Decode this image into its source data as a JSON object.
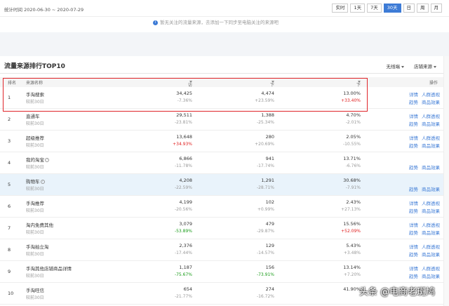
{
  "topbar": {
    "range_label": "统计时间 2020-06-30 ~ 2020-07-29",
    "periods": [
      "实时",
      "1天",
      "7天",
      "30天",
      "日",
      "周",
      "月"
    ],
    "active_period": "30天"
  },
  "notice": {
    "text": "暂无关注的流量来源，去添加一下同步至电脑关注的来源吧"
  },
  "panel": {
    "title": "流量来源排行TOP10",
    "mode_select": "无线端",
    "source_select": "店铺来源"
  },
  "table": {
    "headers": [
      "排名",
      "来源名称",
      "访客数",
      "下单买家数",
      "下单转化率",
      "操作"
    ],
    "rows": [
      {
        "rank": "1",
        "name": "手淘搜索",
        "sub": "较前30日",
        "visitors": "34,425",
        "visitors_chg": "-7.36%",
        "buyers": "4,474",
        "buyers_chg": "+23.59%",
        "rate": "13.00%",
        "rate_chg": "+33.40%",
        "actions": [
          "详情",
          "趋势",
          "人群透视",
          "商品效果"
        ]
      },
      {
        "rank": "2",
        "name": "直通车",
        "sub": "较前30日",
        "visitors": "29,511",
        "visitors_chg": "-23.81%",
        "buyers": "1,388",
        "buyers_chg": "-25.34%",
        "rate": "4.70%",
        "rate_chg": "-2.01%",
        "actions": [
          "详情",
          "趋势",
          "人群透视",
          "商品效果"
        ]
      },
      {
        "rank": "3",
        "name": "超级推荐",
        "sub": "较前30日",
        "visitors": "13,648",
        "visitors_chg": "+34.93%",
        "buyers": "280",
        "buyers_chg": "+20.69%",
        "rate": "2.05%",
        "rate_chg": "-10.55%",
        "actions": [
          "详情",
          "趋势",
          "人群透视",
          "商品效果"
        ]
      },
      {
        "rank": "4",
        "name": "我的淘宝",
        "sub": "较前30日",
        "visitors": "6,866",
        "visitors_chg": "-11.78%",
        "buyers": "941",
        "buyers_chg": "-17.74%",
        "rate": "13.71%",
        "rate_chg": "-6.76%",
        "actions": [
          "",
          "趋势",
          "",
          "商品效果"
        ]
      },
      {
        "rank": "5",
        "name": "购物车",
        "sub": "较前30日",
        "visitors": "4,208",
        "visitors_chg": "-22.59%",
        "buyers": "1,291",
        "buyers_chg": "-28.71%",
        "rate": "30.68%",
        "rate_chg": "-7.91%",
        "actions": [
          "",
          "趋势",
          "",
          "商品效果"
        ]
      },
      {
        "rank": "6",
        "name": "手淘推荐",
        "sub": "较前30日",
        "visitors": "4,199",
        "visitors_chg": "-20.56%",
        "buyers": "102",
        "buyers_chg": "+0.99%",
        "rate": "2.43%",
        "rate_chg": "+27.13%",
        "actions": [
          "详情",
          "趋势",
          "人群透视",
          "商品效果"
        ]
      },
      {
        "rank": "7",
        "name": "淘内免费其他",
        "sub": "较前30日",
        "visitors": "3,079",
        "visitors_chg": "-53.89%",
        "buyers": "479",
        "buyers_chg": "-29.87%",
        "rate": "15.56%",
        "rate_chg": "+52.09%",
        "actions": [
          "详情",
          "趋势",
          "人群透视",
          "商品效果"
        ]
      },
      {
        "rank": "8",
        "name": "手淘拍立淘",
        "sub": "较前30日",
        "visitors": "2,376",
        "visitors_chg": "-17.44%",
        "buyers": "129",
        "buyers_chg": "-14.57%",
        "rate": "5.43%",
        "rate_chg": "+3.48%",
        "actions": [
          "详情",
          "趋势",
          "人群透视",
          "商品效果"
        ]
      },
      {
        "rank": "9",
        "name": "手淘其他店铺商品详情",
        "sub": "较前30日",
        "visitors": "1,187",
        "visitors_chg": "-75.67%",
        "buyers": "156",
        "buyers_chg": "-73.91%",
        "rate": "13.14%",
        "rate_chg": "+7.20%",
        "actions": [
          "详情",
          "趋势",
          "人群透视",
          "商品效果"
        ]
      },
      {
        "rank": "10",
        "name": "手淘旺信",
        "sub": "较前30日",
        "visitors": "654",
        "visitors_chg": "-21.77%",
        "buyers": "274",
        "buyers_chg": "-16.72%",
        "rate": "41.90%",
        "rate_chg": "",
        "actions": [
          "",
          "",
          "",
          ""
        ]
      }
    ]
  },
  "watermark": "头条 @电商老斑鸠",
  "colors": {
    "accent": "#3d7bd6",
    "negative": "#1a9c1a",
    "positive": "#e02020",
    "highlight_box": "#e0252a"
  }
}
